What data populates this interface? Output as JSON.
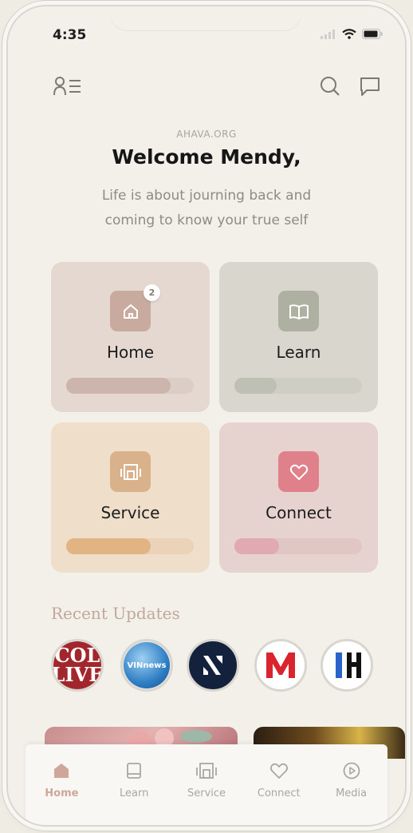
{
  "status": {
    "time": "4:35"
  },
  "header": {
    "org": "AHAVA.ORG",
    "welcome": "Welcome Mendy,",
    "subtitle": "Life is about journing back and coming to know your true self"
  },
  "cards": [
    {
      "label": "Home",
      "badge": "2",
      "progress": 0.82,
      "bg": "#e4d8d1",
      "tile": "#c8aa9e",
      "track": "#dccdc6",
      "fill": "#cbb5ad"
    },
    {
      "label": "Learn",
      "progress": 0.33,
      "bg": "#d9d7cd",
      "tile": "#aeb0a2",
      "track": "#cfcec4",
      "fill": "#bfc0b4"
    },
    {
      "label": "Service",
      "progress": 0.66,
      "bg": "#efdfca",
      "tile": "#d9b18b",
      "track": "#ead3b8",
      "fill": "#e2b483"
    },
    {
      "label": "Connect",
      "progress": 0.35,
      "bg": "#e6d3cf",
      "tile": "#e0808a",
      "track": "#e0c7c3",
      "fill": "#e0aab0"
    }
  ],
  "recent": {
    "title": "Recent Updates",
    "avatars": [
      {
        "name": "COLlive",
        "lines": [
          "COL",
          "LIVE"
        ]
      },
      {
        "name": "VINnews",
        "lines": [
          "VINnews"
        ]
      },
      {
        "name": "N logo",
        "lines": []
      },
      {
        "name": "M logo",
        "lines": []
      },
      {
        "name": "Chabad logo",
        "lines": []
      }
    ]
  },
  "nav": [
    {
      "label": "Home",
      "active": true
    },
    {
      "label": "Learn"
    },
    {
      "label": "Service"
    },
    {
      "label": "Connect"
    },
    {
      "label": "Media"
    }
  ]
}
